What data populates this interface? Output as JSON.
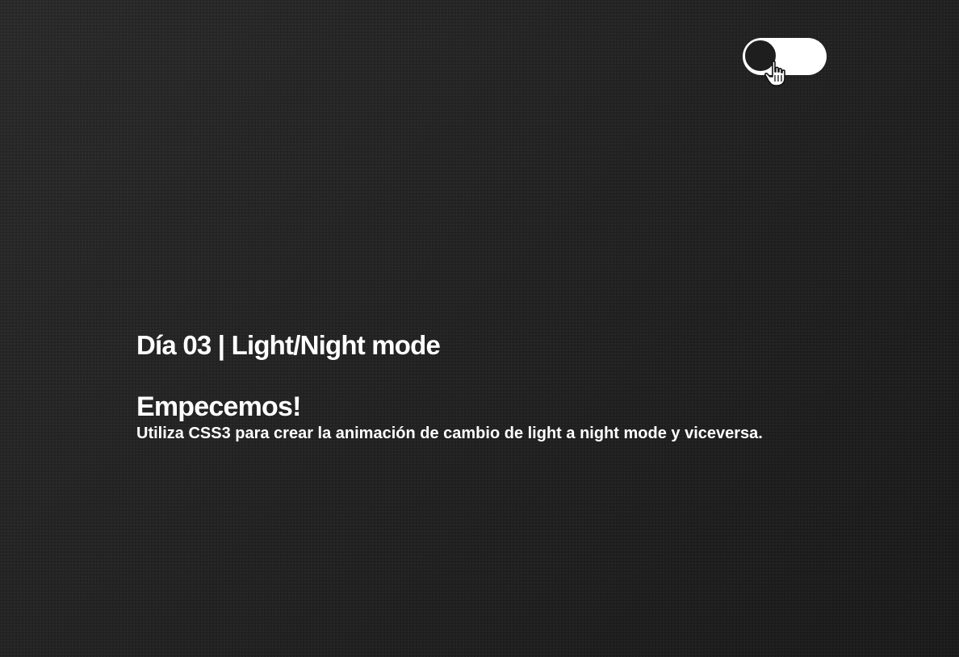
{
  "page": {
    "heading": "Día 03 | Light/Night mode",
    "subheading": "Empecemos!",
    "description": "Utiliza CSS3 para crear la animación de cambio de light a night mode y viceversa."
  },
  "toggle": {
    "state": "night",
    "track_color": "#ffffff",
    "knob_color": "#1e1e1e"
  },
  "cursor": {
    "icon": "hand-pointer-icon"
  },
  "colors": {
    "background": "#232323",
    "text": "#ffffff"
  }
}
